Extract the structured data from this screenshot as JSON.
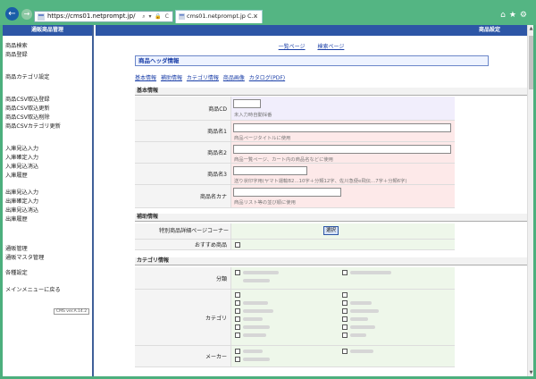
{
  "browser": {
    "url": "https://cms01.netprompt.jp/",
    "tab_title": "cms01.netprompt.jp  C...",
    "tab_close": "×",
    "addr_tools": "⌕ ▾ 🔒 C"
  },
  "sidebar": {
    "header": "通販商品管理",
    "items": [
      "商品検索",
      "商品登録",
      "商品カテゴリ設定",
      "商品CSV取込登録",
      "商品CSV取込更新",
      "商品CSV取込削除",
      "商品CSVカテゴリ更新",
      "入庫見込入力",
      "入庫確定入力",
      "入庫見込消込",
      "入庫履歴",
      "出庫見込入力",
      "出庫確定入力",
      "出庫見込消込",
      "出庫履歴",
      "通販管理",
      "通販マスタ管理",
      "各種設定",
      "メインメニューに戻る"
    ],
    "version": "CMS ver.A.14.2"
  },
  "main": {
    "header": "商品設定",
    "links": [
      "一覧ページ",
      "検索ページ"
    ],
    "title": "商品ヘッダ情報",
    "subnav": [
      "基本情報",
      "補助情報",
      "カテゴリ情報",
      "商品画像",
      "カタログ(PDF)"
    ],
    "section_basic": "基本情報",
    "fields": {
      "cd_label": "商品CD",
      "cd_hint": "未入力時自動採番",
      "name1_label": "商品名1",
      "name1_hint": "商品ページタイトルに使用",
      "name2_label": "商品名2",
      "name2_hint": "商品一覧ページ、カート内の商品名などに使用",
      "name3_label": "商品名3",
      "name3_hint": "送り状印字用(ヤマト運輸B2…10字＋分類12字、佐川急便e飛伝…7字＋分類6字)",
      "kana_label": "商品名カナ",
      "kana_hint": "商品リスト等の並び順に使用"
    },
    "section_aux": "補助情報",
    "aux": {
      "corner_label": "特別商品詳細ページコーナー",
      "select_button": "選択",
      "recommend_label": "おすすめ商品"
    },
    "section_category": "カテゴリ情報",
    "category": {
      "bunrui_label": "分類",
      "category_label": "カテゴリ",
      "maker_label": "メーカー"
    }
  },
  "colors": {
    "header_blue": "#2d56a6",
    "chrome_green": "#54b583",
    "link_blue": "#1b3fa8"
  }
}
